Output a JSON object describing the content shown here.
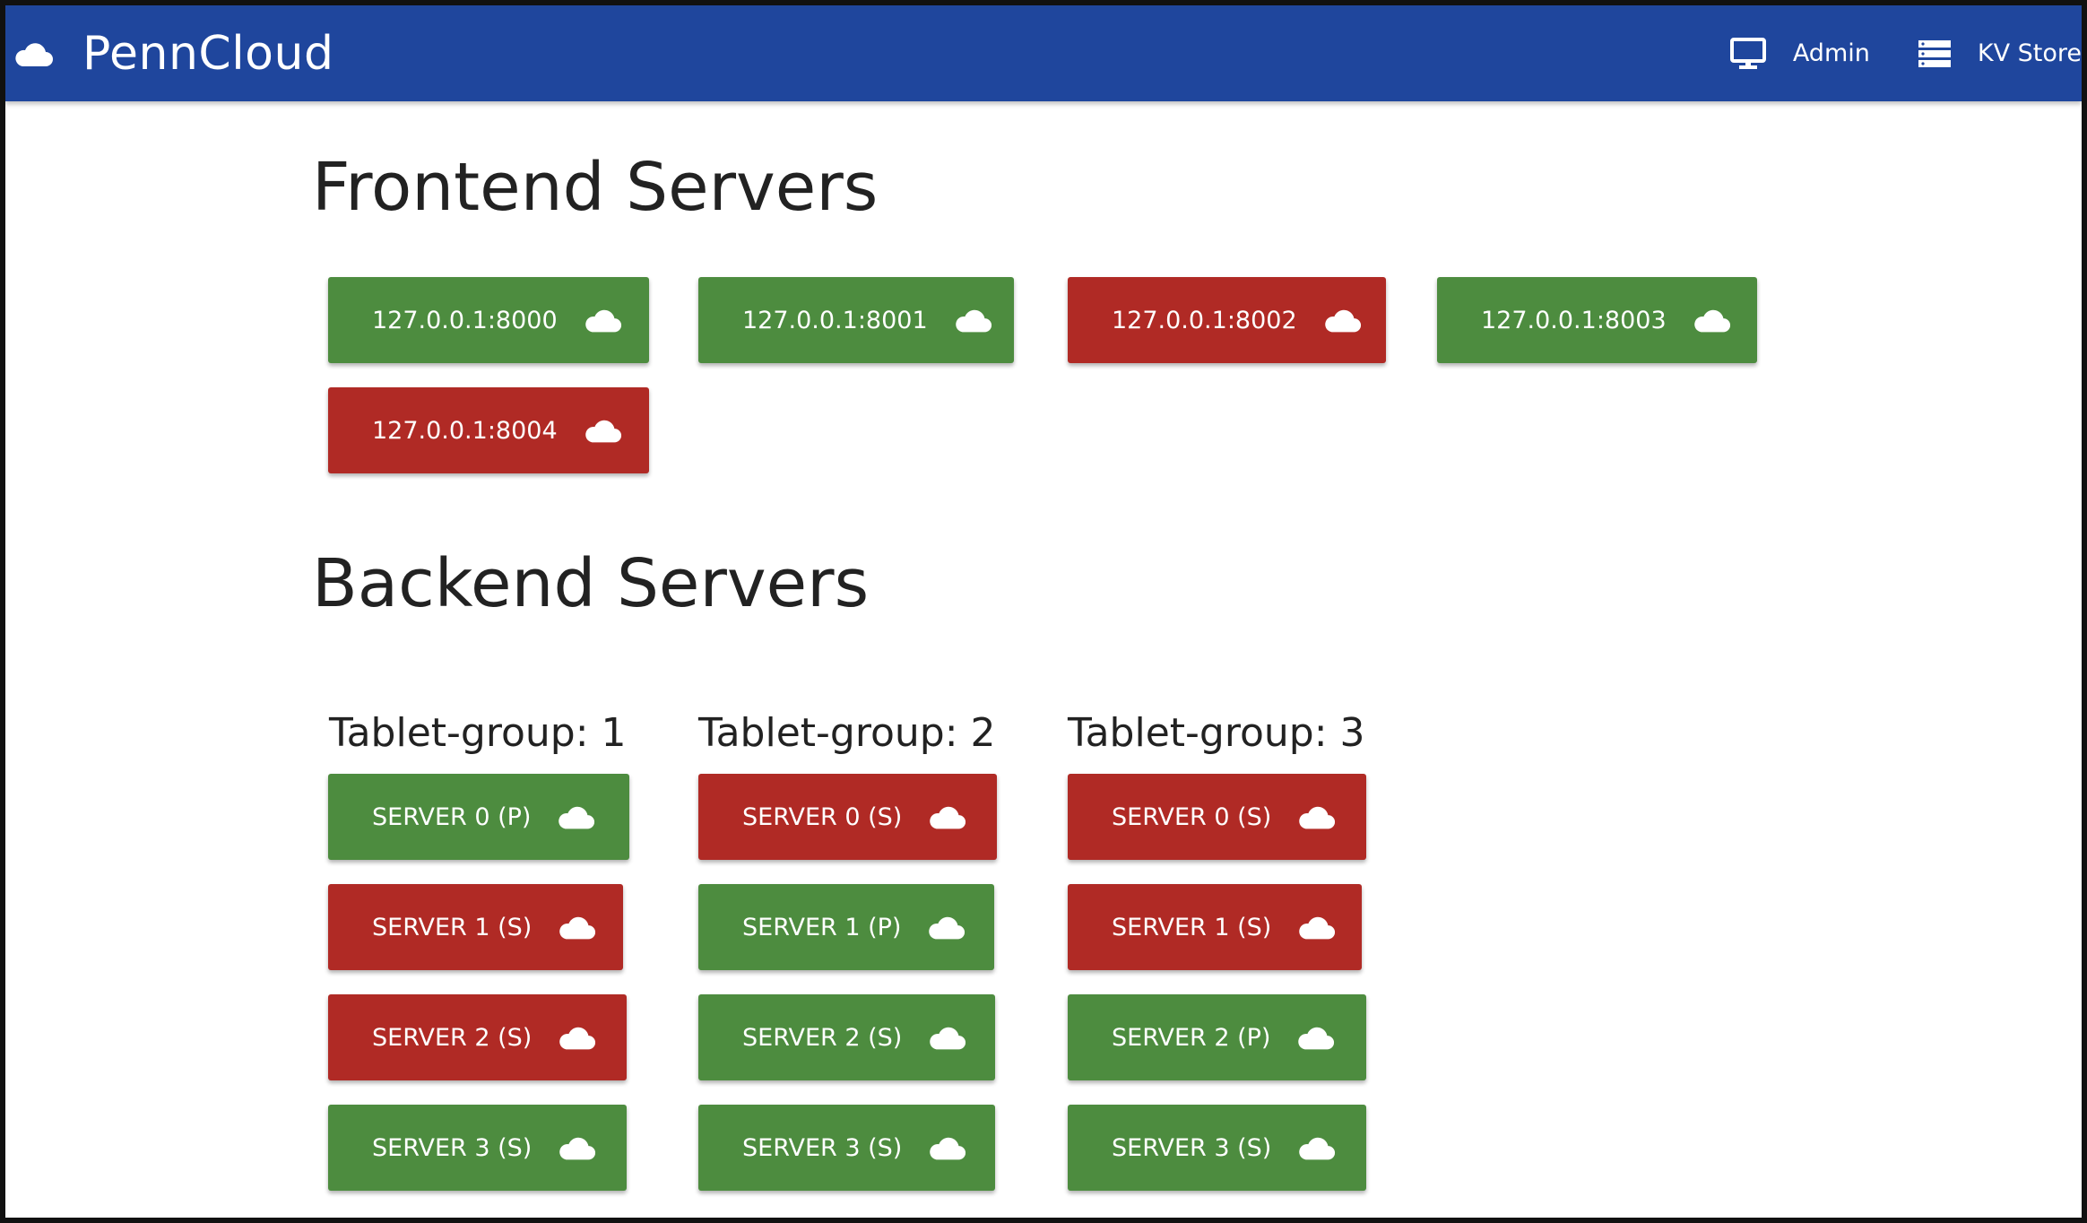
{
  "colors": {
    "navbar": "#1f469d",
    "up": "#4d8c3f",
    "down": "#b02a25"
  },
  "navbar": {
    "brand": "PennCloud",
    "links": [
      {
        "label": "Admin",
        "icon": "monitor-icon"
      },
      {
        "label": "KV Store",
        "icon": "server-icon"
      }
    ]
  },
  "frontend": {
    "title": "Frontend Servers",
    "servers": [
      {
        "label": "127.0.0.1:8000",
        "status": "up"
      },
      {
        "label": "127.0.0.1:8001",
        "status": "up"
      },
      {
        "label": "127.0.0.1:8002",
        "status": "down"
      },
      {
        "label": "127.0.0.1:8003",
        "status": "up"
      },
      {
        "label": "127.0.0.1:8004",
        "status": "down"
      }
    ]
  },
  "backend": {
    "title": "Backend Servers",
    "groups": [
      {
        "title": "Tablet-group: 1",
        "servers": [
          {
            "label": "SERVER 0 (P)",
            "status": "up"
          },
          {
            "label": "SERVER 1 (S)",
            "status": "down"
          },
          {
            "label": "SERVER 2 (S)",
            "status": "down"
          },
          {
            "label": "SERVER 3 (S)",
            "status": "up"
          }
        ]
      },
      {
        "title": "Tablet-group: 2",
        "servers": [
          {
            "label": "SERVER 0 (S)",
            "status": "down"
          },
          {
            "label": "SERVER 1 (P)",
            "status": "up"
          },
          {
            "label": "SERVER 2 (S)",
            "status": "up"
          },
          {
            "label": "SERVER 3 (S)",
            "status": "up"
          }
        ]
      },
      {
        "title": "Tablet-group: 3",
        "servers": [
          {
            "label": "SERVER 0 (S)",
            "status": "down"
          },
          {
            "label": "SERVER 1 (S)",
            "status": "down"
          },
          {
            "label": "SERVER 2 (P)",
            "status": "up"
          },
          {
            "label": "SERVER 3 (S)",
            "status": "up"
          }
        ]
      }
    ]
  }
}
